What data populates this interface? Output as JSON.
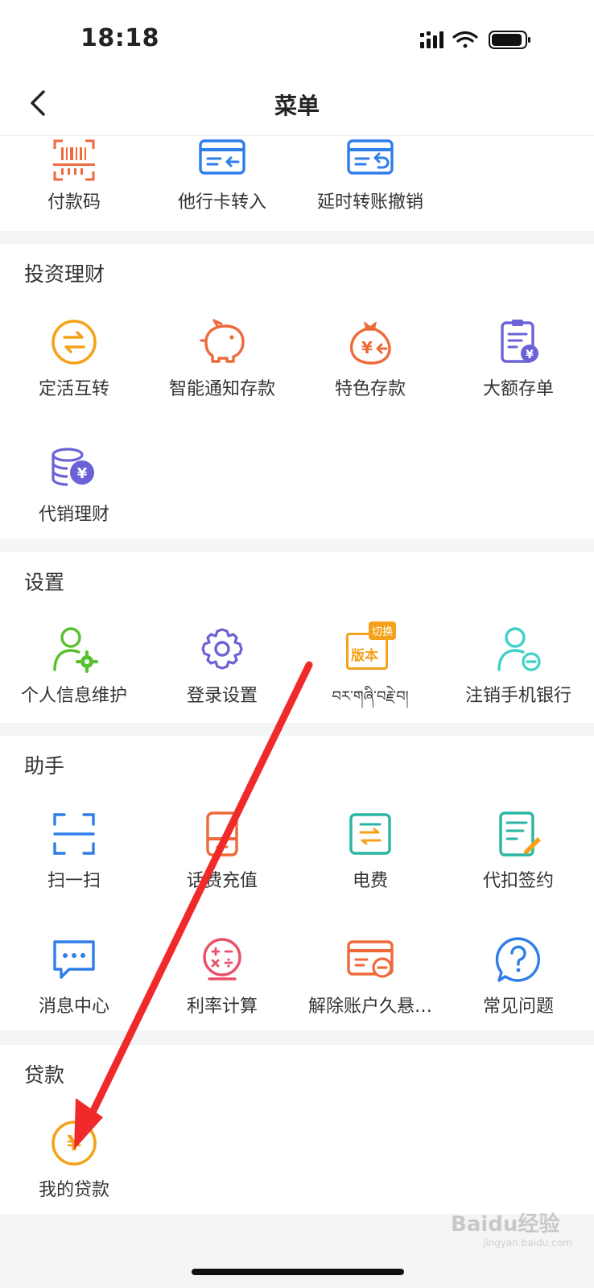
{
  "status_bar": {
    "time": "18:18"
  },
  "header": {
    "title": "菜单"
  },
  "top_row": [
    {
      "label": "付款码",
      "icon": "barcode-scan-icon"
    },
    {
      "label": "他行卡转入",
      "icon": "card-transfer-in-icon"
    },
    {
      "label": "延时转账撤销",
      "icon": "card-undo-icon"
    }
  ],
  "invest": {
    "title": "投资理财",
    "items": [
      {
        "label": "定活互转",
        "icon": "exchange-circle-icon"
      },
      {
        "label": "智能通知存款",
        "icon": "piggy-bank-icon"
      },
      {
        "label": "特色存款",
        "icon": "money-bag-icon"
      },
      {
        "label": "大额存单",
        "icon": "certificate-icon"
      },
      {
        "label": "代销理财",
        "icon": "coins-icon"
      }
    ]
  },
  "settings": {
    "title": "设置",
    "badge": "切换",
    "version_text": "版本",
    "items": [
      {
        "label": "个人信息维护",
        "icon": "user-gear-icon"
      },
      {
        "label": "登录设置",
        "icon": "gear-icon"
      },
      {
        "label": "བར་གཞི་བརྗེ་བ།",
        "icon": "version-switch-icon"
      },
      {
        "label": "注销手机银行",
        "icon": "user-minus-icon"
      }
    ]
  },
  "assistant": {
    "title": "助手",
    "items": [
      {
        "label": "扫一扫",
        "icon": "scan-frame-icon"
      },
      {
        "label": "话费充值",
        "icon": "phone-topup-icon"
      },
      {
        "label": "电费",
        "icon": "electric-bill-icon"
      },
      {
        "label": "代扣签约",
        "icon": "sign-document-icon"
      },
      {
        "label": "消息中心",
        "icon": "message-icon"
      },
      {
        "label": "利率计算",
        "icon": "calculator-icon"
      },
      {
        "label": "解除账户久悬…",
        "icon": "card-remove-icon"
      },
      {
        "label": "常见问题",
        "icon": "question-icon"
      }
    ]
  },
  "loan": {
    "title": "贷款",
    "items": [
      {
        "label": "我的贷款",
        "icon": "yuan-coin-icon"
      }
    ]
  },
  "watermark": {
    "brand": "Baidu经验",
    "url": "jingyan.baidu.com"
  }
}
